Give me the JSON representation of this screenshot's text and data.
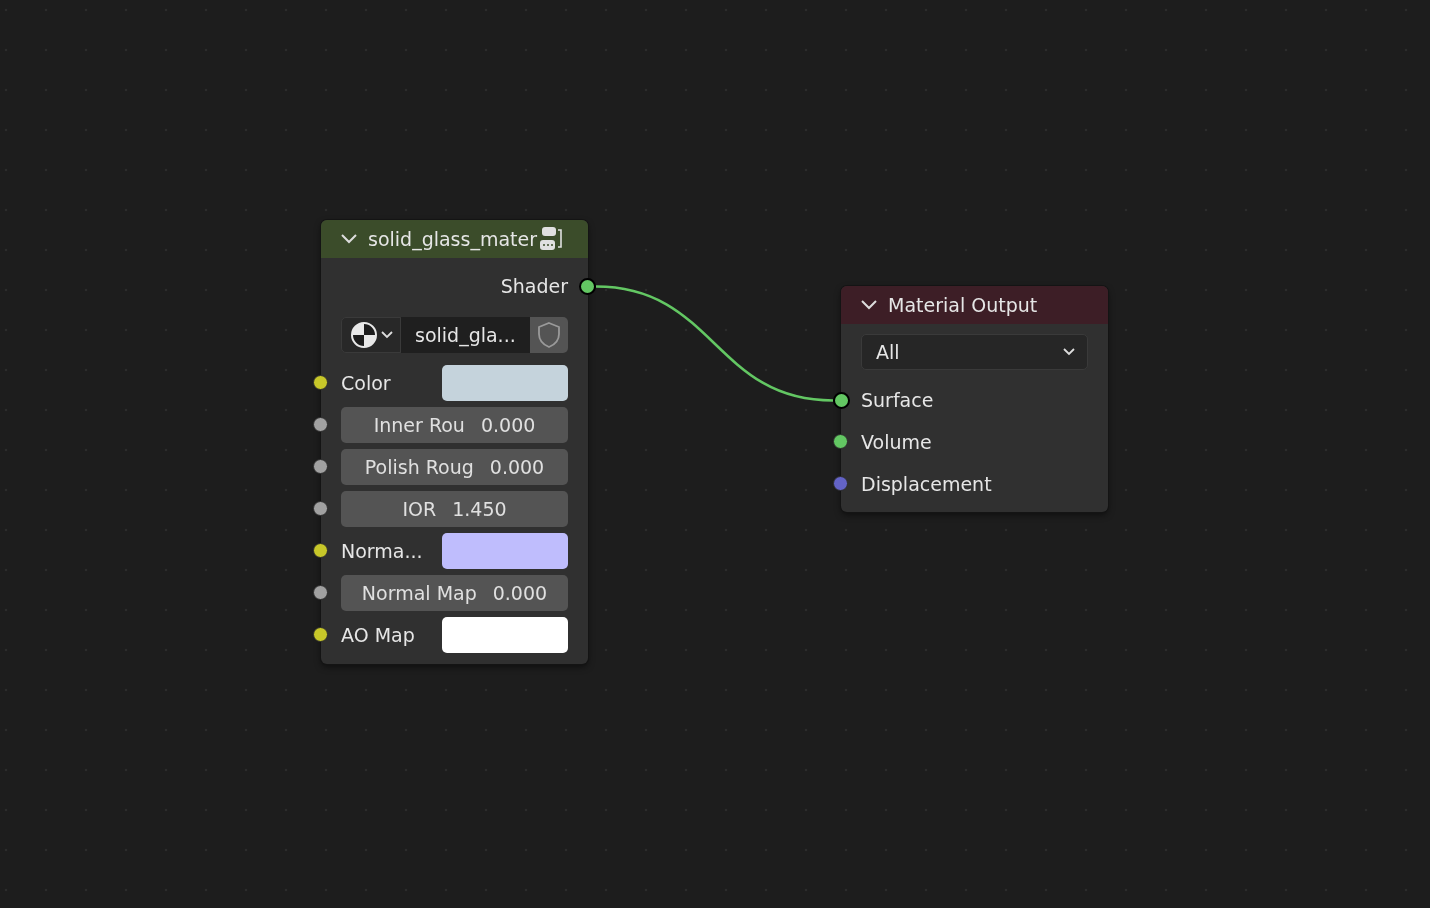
{
  "nodes": [
    {
      "kind": "group",
      "title": "solid_glass_mater",
      "color": "#3b4c2a",
      "expanded": true,
      "outputs": [
        {
          "label": "Shader",
          "color": "#63c763",
          "connected": true
        }
      ],
      "datablock": {
        "name": "solid_gla...",
        "fake_user": false
      },
      "inputs": [
        {
          "kind": "color",
          "label": "Color",
          "color": "#c7c729",
          "swatch": {
            "color": "#c5d3dc"
          },
          "connected": false
        },
        {
          "kind": "value",
          "label": "Inner Rou",
          "value": "0.000",
          "color": "#a1a1a1",
          "connected": false
        },
        {
          "kind": "value",
          "label": "Polish Roug",
          "value": "0.000",
          "color": "#a1a1a1",
          "connected": false
        },
        {
          "kind": "value",
          "label": "IOR",
          "value": "1.450",
          "color": "#a1a1a1",
          "connected": false
        },
        {
          "kind": "color",
          "label": "Norma...",
          "color": "#c7c729",
          "swatch": {
            "color": "#bfbdfd"
          },
          "connected": false
        },
        {
          "kind": "value",
          "label": "Normal Map",
          "value": "0.000",
          "color": "#a1a1a1",
          "connected": false
        },
        {
          "kind": "color",
          "label": "AO Map",
          "color": "#c7c729",
          "swatch": {
            "color": "#ffffff"
          },
          "connected": false
        }
      ]
    },
    {
      "kind": "output",
      "title": "Material Output",
      "color": "#3d1e26",
      "expanded": true,
      "target": {
        "value": "All"
      },
      "inputs": [
        {
          "kind": "label",
          "label": "Surface",
          "color": "#63c763",
          "connected": true
        },
        {
          "kind": "label",
          "label": "Volume",
          "color": "#63c763",
          "connected": false
        },
        {
          "kind": "label",
          "label": "Displacement",
          "color": "#6363c7",
          "connected": false
        }
      ]
    }
  ]
}
